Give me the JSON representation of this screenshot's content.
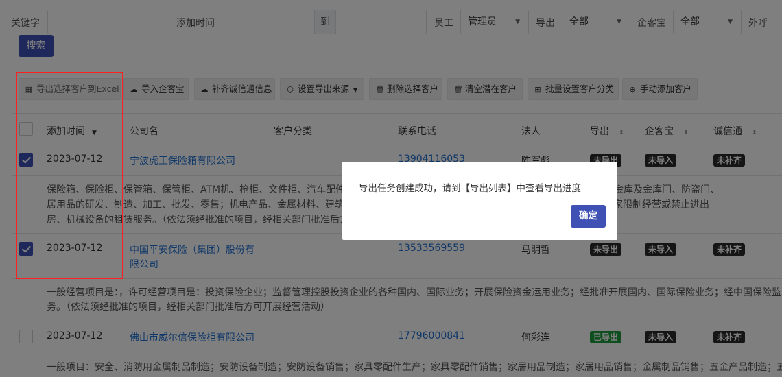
{
  "filters": {
    "keyword_label": "关键字",
    "keyword_value": "",
    "date_label": "添加时间",
    "date_to": "到",
    "date_from_value": "",
    "date_to_value": "",
    "staff_label": "员工",
    "staff_value": "管理员",
    "export_label": "导出",
    "export_value": "全部",
    "qikebao_label": "企客宝",
    "qikebao_value": "全部",
    "outcall_label": "外呼",
    "search_label": "搜索"
  },
  "toolbar": {
    "export_excel": "导出选择客户到Excel",
    "import_qikebao": "导入企客宝",
    "complete_chengxintong": "补齐诚信通信息",
    "set_export_source": "设置导出来源",
    "delete_selected": "删除选择客户",
    "clear_potential": "清空潜在客户",
    "batch_category": "批量设置客户分类",
    "manual_add": "手动添加客户"
  },
  "table": {
    "headers": {
      "added_time": "添加时间",
      "company": "公司名",
      "category": "客户分类",
      "phone": "联系电话",
      "legal_person": "法人",
      "export": "导出",
      "qikebao": "企客宝",
      "chengxintong": "诚信通"
    },
    "rows": [
      {
        "checked": true,
        "date": "2023-07-12",
        "company": "宁波虎王保险箱有限公司",
        "phone": "13904116053",
        "legal": "陈军彪",
        "export": "未导出",
        "qikebao": "未导入",
        "cxt": "未补齐",
        "desc1": "保险箱、保险柜、保管箱、保管柜、ATM机、枪柜、文件柜、汽车配件、五金配件的研发、制造、加工、批发、零售；安防产品、银行金库及金库门、防盗门、",
        "desc2": "居用品的研发、制造、加工、批发、零售；机电产品、金属材料、建筑材料的批发、零售；自营和代理各类货物和技术的进出口，但国家限制经营或禁止进出",
        "desc3": "房、机械设备的租赁服务。（依法须经批准的项目，经相关部门批准后方可开展经营活动）"
      },
      {
        "checked": true,
        "date": "2023-07-12",
        "company_line1": "中国平安保险（集团）股份有",
        "company_line2": "限公司",
        "phone": "13533569559",
        "legal": "马明哲",
        "export": "未导出",
        "qikebao": "未导入",
        "cxt": "未补齐",
        "desc1": "一般经营项目是：，许可经营项目是：投资保险企业；监督管理控股投资企业的各种国内、国际业务；开展保险资金运用业务；经批准开展国内、国际保险业务；经中国保险监",
        "desc2": "务。（依法须经批准的项目，经相关部门批准后方可开展经营活动）"
      },
      {
        "checked": false,
        "date": "2023-07-12",
        "company": "佛山市威尔信保险柜有限公司",
        "phone": "17796000841",
        "legal": "何彩连",
        "export": "已导出",
        "qikebao": "未导入",
        "cxt": "未补齐",
        "desc1": "一般项目：安全、消防用金属制品制造；安防设备制造；安防设备销售；家具零配件生产；家具零配件销售；家居用品制造；家居用品销售；金属制品销售；五金产品制造；五金"
      }
    ]
  },
  "dialog": {
    "message": "导出任务创建成功，请到【导出列表】中查看导出进度",
    "ok_label": "确定"
  },
  "colors": {
    "primary": "#3f51b5",
    "link": "#1e6fd0",
    "highlight_box": "#ff2020",
    "badge_dark": "#2b2b2b",
    "badge_green": "#1e9e3e"
  }
}
